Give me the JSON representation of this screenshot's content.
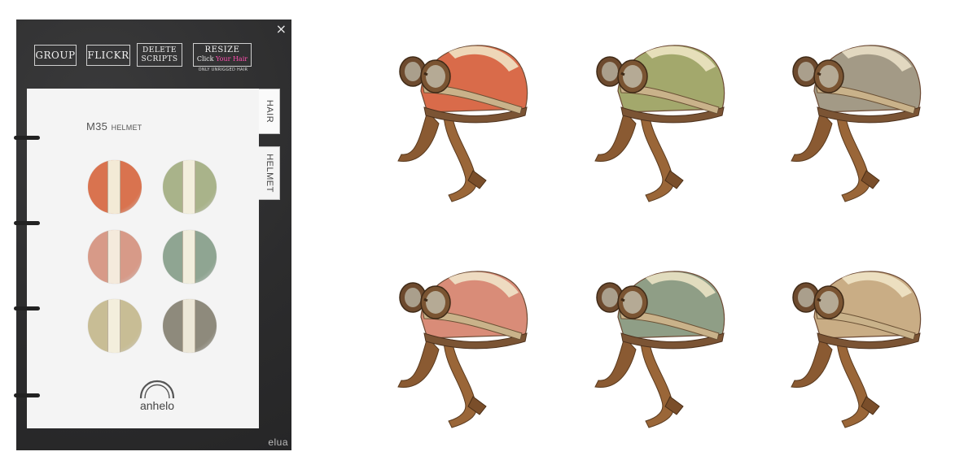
{
  "hud": {
    "close": "×",
    "buttons": {
      "group": "GROUP",
      "flickr": "FLICKR",
      "delete_line1": "DELETE",
      "delete_line2": "SCRIPTS",
      "resize_line1": "RESIZE",
      "resize_click": "Click",
      "resize_target": "Your Hair"
    },
    "note": "ONLY UNRIGGED HAIR",
    "page_title": "M35",
    "page_subtitle": "HELMET",
    "tabs": [
      "HAIR",
      "HELMET"
    ],
    "logo_text": "anhelo",
    "brand": "elua",
    "swatches": [
      {
        "color": "#d9734f",
        "stripe": "#f3ead6"
      },
      {
        "color": "#a9b38a",
        "stripe": "#f2eedc"
      },
      {
        "color": "#d79a88",
        "stripe": "#f4eadc"
      },
      {
        "color": "#8fa592",
        "stripe": "#f1eedd"
      },
      {
        "color": "#c8bd95",
        "stripe": "#f3eedc"
      },
      {
        "color": "#8e8a7c",
        "stripe": "#ece7d7"
      }
    ]
  },
  "helmets": [
    {
      "shell": "#d96b4a",
      "band": "#efe3c4"
    },
    {
      "shell": "#a3a86c",
      "band": "#ede4c3"
    },
    {
      "shell": "#a39a86",
      "band": "#e9dfc6"
    },
    {
      "shell": "#d98c78",
      "band": "#efe3c9"
    },
    {
      "shell": "#8f9e86",
      "band": "#eae2c4"
    },
    {
      "shell": "#c9ad85",
      "band": "#efe4c6"
    }
  ]
}
